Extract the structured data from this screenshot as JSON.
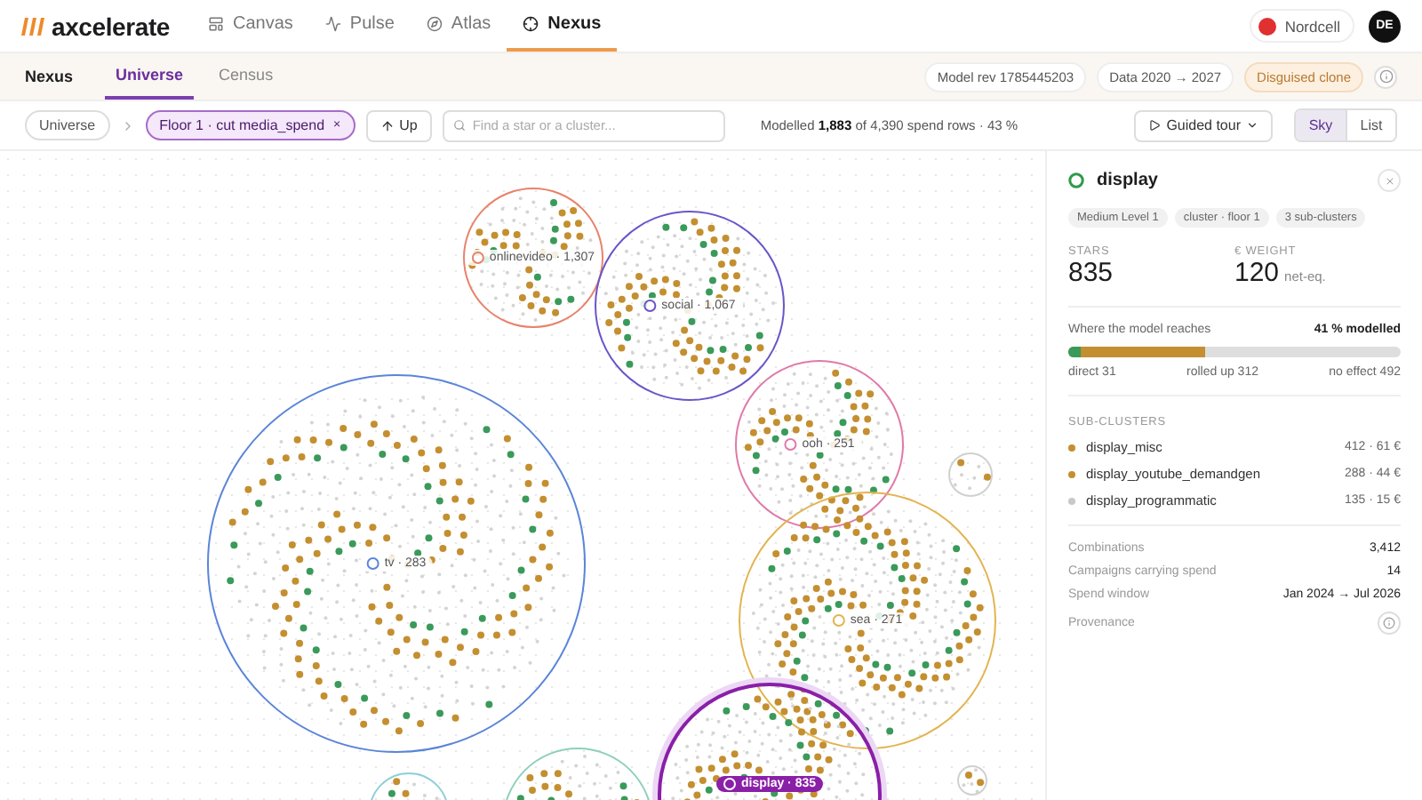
{
  "brand": {
    "name": "axcelerate"
  },
  "nav": {
    "tabs": [
      {
        "label": "Canvas",
        "selected": false
      },
      {
        "label": "Pulse",
        "selected": false
      },
      {
        "label": "Atlas",
        "selected": false
      },
      {
        "label": "Nexus",
        "selected": true
      }
    ],
    "workspace": {
      "label": "Nordcell",
      "color": "#e03030"
    },
    "avatar": "DE"
  },
  "subbar": {
    "title": "Nexus",
    "tabs": [
      {
        "label": "Universe",
        "selected": true
      },
      {
        "label": "Census",
        "selected": false
      }
    ],
    "chips": [
      {
        "label": "Model rev 1785445203",
        "kind": "plain"
      },
      {
        "label": "Data 2020 → 2027",
        "kind": "plain"
      },
      {
        "label": "Disguised clone",
        "kind": "warn"
      }
    ]
  },
  "toolbar": {
    "breadcrumb": [
      {
        "label": "Universe",
        "kind": "root"
      },
      {
        "label": "Floor 1 · cut media_spend",
        "kind": "filter",
        "remove": "×"
      }
    ],
    "up": "Up",
    "search": {
      "placeholder": "Find a star or a cluster..."
    },
    "status": "Modelled **1,883** of 4,390 spend rows · 43 %",
    "tour": "Guided tour",
    "views": [
      {
        "label": "Sky",
        "selected": true
      },
      {
        "label": "List",
        "selected": false
      }
    ]
  },
  "clusters": [
    {
      "label": "onlinevideo · 1,307",
      "color": "#e8826a",
      "selected": false
    },
    {
      "label": "social · 1,067",
      "color": "#6a55c8",
      "selected": false
    },
    {
      "label": "ooh · 251",
      "color": "#e07aa8",
      "selected": false
    },
    {
      "label": "tv · 283",
      "color": "#5a85d8",
      "selected": false
    },
    {
      "label": "sea · 271",
      "color": "#e2b450",
      "selected": false
    },
    {
      "label": "display · 835",
      "color": "#8a1fa8",
      "selected": true
    }
  ],
  "panel": {
    "title": "display",
    "tags": [
      "Medium Level 1",
      "cluster · floor 1",
      "3 sub-clusters"
    ],
    "stats": [
      {
        "label": "STARS",
        "value": "835"
      },
      {
        "label": "€ WEIGHT",
        "value": "120",
        "unit": "net-eq."
      }
    ],
    "reach": {
      "label": "Where the model reaches",
      "summary": "41 % modelled",
      "fills": [
        {
          "level": 0.41,
          "color": "#c48f30"
        },
        {
          "level": 0.04,
          "color": "#3a9a5a"
        }
      ],
      "legend": [
        "direct 31",
        "rolled up 312",
        "no effect 492"
      ]
    },
    "subclusters_title": "SUB-CLUSTERS",
    "subclusters": [
      {
        "name": "display_misc",
        "value": "412 · 61 €",
        "color": "#c48f30"
      },
      {
        "name": "display_youtube_demandgen",
        "value": "288 · 44 €",
        "color": "#c48f30"
      },
      {
        "name": "display_programmatic",
        "value": "135 · 15 €",
        "color": "#c8c8c8"
      }
    ],
    "facts": [
      {
        "label": "Combinations",
        "value": "3,412",
        "kind": "text"
      },
      {
        "label": "Campaigns carrying spend",
        "value": "14",
        "kind": "text"
      },
      {
        "label": "Spend window",
        "value": "Jan 2024 → Jul 2026",
        "kind": "text"
      },
      {
        "label": "Provenance",
        "kind": "info"
      }
    ]
  }
}
